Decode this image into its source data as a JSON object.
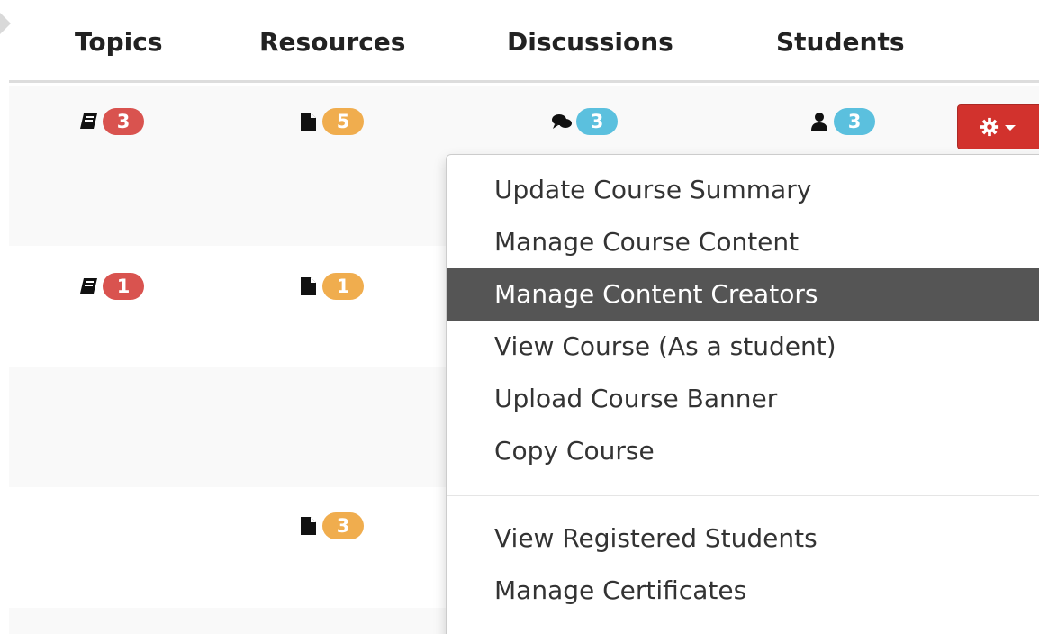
{
  "headers": {
    "topics": "Topics",
    "resources": "Resources",
    "discussions": "Discussions",
    "students": "Students"
  },
  "rows": [
    {
      "topics": "3",
      "resources": "5",
      "discussions": "3",
      "students": "3"
    },
    {
      "topics": "1",
      "resources": "1"
    },
    {},
    {
      "resources": "3"
    },
    {}
  ],
  "icons": {
    "topics": "book-icon",
    "resources": "file-icon",
    "discussions": "comments-icon",
    "students": "user-icon",
    "actions": "gear-icon"
  },
  "colors": {
    "topics_badge": "#d9534f",
    "resources_badge": "#f0ad4e",
    "discussions_badge": "#5bc0de",
    "students_badge": "#5bc0de",
    "action_button": "#d2322d",
    "active_item": "#555555"
  },
  "dropdown": {
    "items": [
      {
        "label": "Update Course Summary"
      },
      {
        "label": "Manage Course Content"
      },
      {
        "label": "Manage Content Creators",
        "active": true
      },
      {
        "label": "View Course (As a student)"
      },
      {
        "label": "Upload Course Banner"
      },
      {
        "label": "Copy Course"
      }
    ],
    "items_after_divider": [
      {
        "label": "View Registered Students"
      },
      {
        "label": "Manage Certificates"
      }
    ]
  }
}
